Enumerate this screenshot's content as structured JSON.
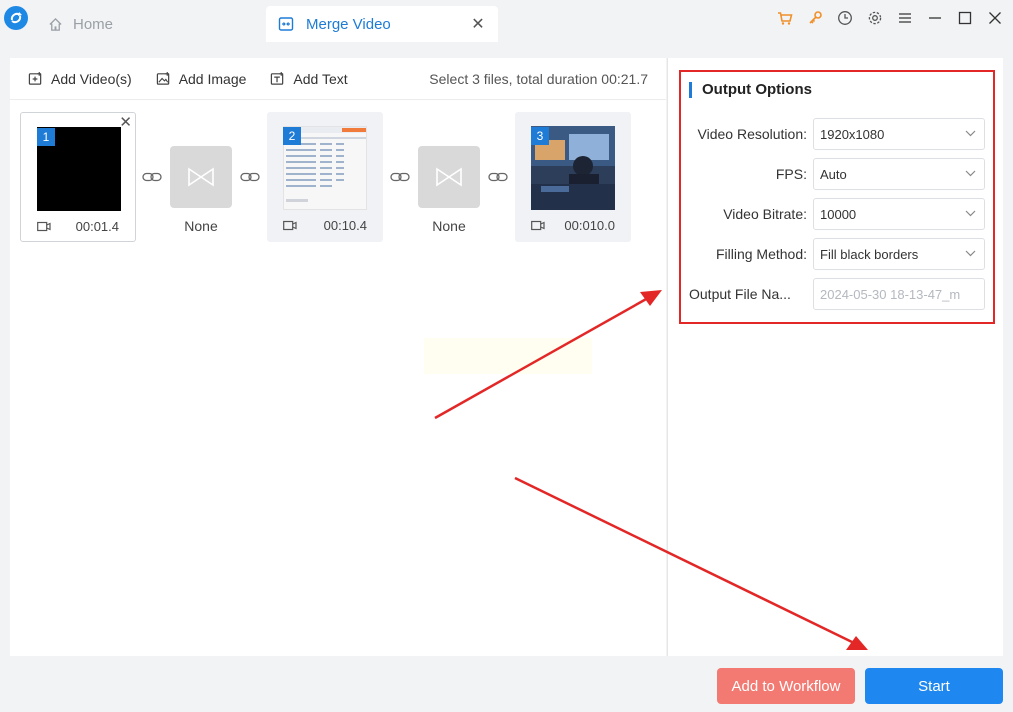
{
  "titlebar": {
    "home_tab": "Home",
    "active_tab": "Merge Video"
  },
  "toolbar": {
    "add_videos": "Add Video(s)",
    "add_image": "Add Image",
    "add_text": "Add Text",
    "status": "Select 3 files, total duration 00:21.7"
  },
  "clips": [
    {
      "number": "1",
      "duration": "00:01.4"
    },
    {
      "number": "2",
      "duration": "00:10.4"
    },
    {
      "number": "3",
      "duration": "00:010.0"
    }
  ],
  "transitions": [
    {
      "label": "None"
    },
    {
      "label": "None"
    }
  ],
  "output_options": {
    "title": "Output Options",
    "resolution_label": "Video Resolution:",
    "resolution_value": "1920x1080",
    "fps_label": "FPS:",
    "fps_value": "Auto",
    "bitrate_label": "Video Bitrate:",
    "bitrate_value": "10000",
    "filling_label": "Filling Method:",
    "filling_value": "Fill black borders",
    "filename_label": "Output File Na...",
    "filename_placeholder": "2024-05-30 18-13-47_m"
  },
  "buttons": {
    "add_to_workflow": "Add to Workflow",
    "start": "Start"
  },
  "colors": {
    "accent": "#1e7bd6",
    "start_button": "#1e88f0",
    "workflow_button": "#f27a72",
    "annotation_red": "#e32727"
  }
}
